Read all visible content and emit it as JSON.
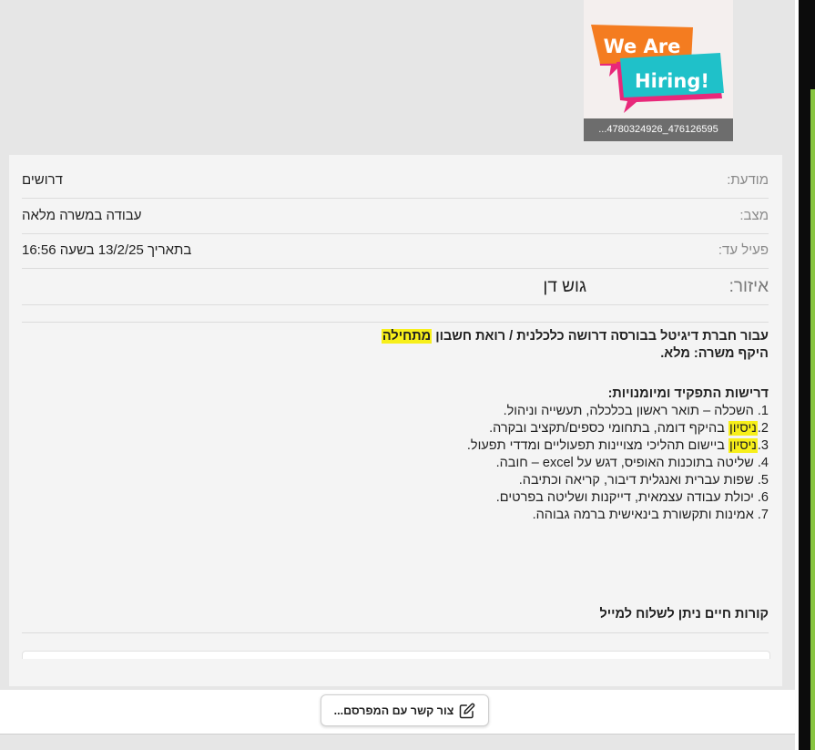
{
  "thumbnail": {
    "banner_line1": "We Are",
    "banner_line2": "Hiring!",
    "caption": "...4780324926_476126595"
  },
  "details": [
    {
      "label": "מודעת:",
      "value": "דרושים"
    },
    {
      "label": "מצב:",
      "value": "עבודה במשרה מלאה"
    },
    {
      "label": "פעיל עד:",
      "value": "בתאריך 13/2/25 בשעה 16:56"
    },
    {
      "label": "איזור:",
      "value": "גוש דן"
    }
  ],
  "description": {
    "intro_line1_a": "עבור חברת דיגיטל בבורסה דרושה כלכלנית / רואת חשבון ",
    "intro_line1_highlight": "מתחילה",
    "intro_line2": "היקף משרה: מלא.",
    "requirements_title": "דרישות התפקיד ומיומנויות:",
    "req1": "1. השכלה – תואר ראשון בכלכלה, תעשייה וניהול.",
    "req2_prefix": "2.",
    "req2_highlight": "ניסיון",
    "req2_rest": " בהיקף דומה, בתחומי כספים/תקציב ובקרה.",
    "req3_prefix": "3.",
    "req3_highlight": "ניסיון",
    "req3_rest": " ביישום תהליכי מצויינות תפעוליים ומדדי תפעול.",
    "req4": "4. שליטה בתוכנות האופיס, דגש על excel – חובה.",
    "req5": "5. שפות עברית ואנגלית דיבור, קריאה וכתיבה.",
    "req6": "6. יכולת עבודה עצמאית, דייקנות ושליטה בפרטים.",
    "req7": "7. אמינות ותקשורת בינאישית ברמה גבוהה."
  },
  "cv_label": "קורות חיים ניתן לשלוח למייל",
  "contact_button": {
    "label": "צור קשר עם המפרסם...",
    "icon": "edit-icon"
  },
  "colors": {
    "highlight": "#f7ef1a",
    "accent_green": "#88c541",
    "banner_orange": "#f47c20",
    "banner_cyan": "#1fc1c9",
    "banner_pink": "#e8287a"
  }
}
